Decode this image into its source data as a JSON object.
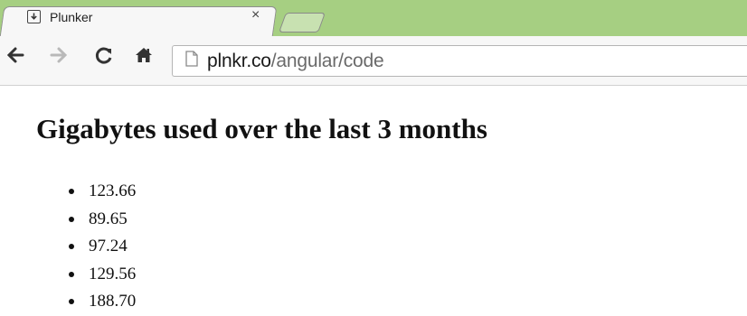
{
  "browser": {
    "tab": {
      "title": "Plunker",
      "close_glyph": "×"
    },
    "address": {
      "domain": "plnkr.co",
      "path": "/angular/code"
    }
  },
  "page": {
    "heading": "Gigabytes used over the last 3 months",
    "values": [
      "123.66",
      "89.65",
      "97.24",
      "129.56",
      "188.70"
    ]
  }
}
